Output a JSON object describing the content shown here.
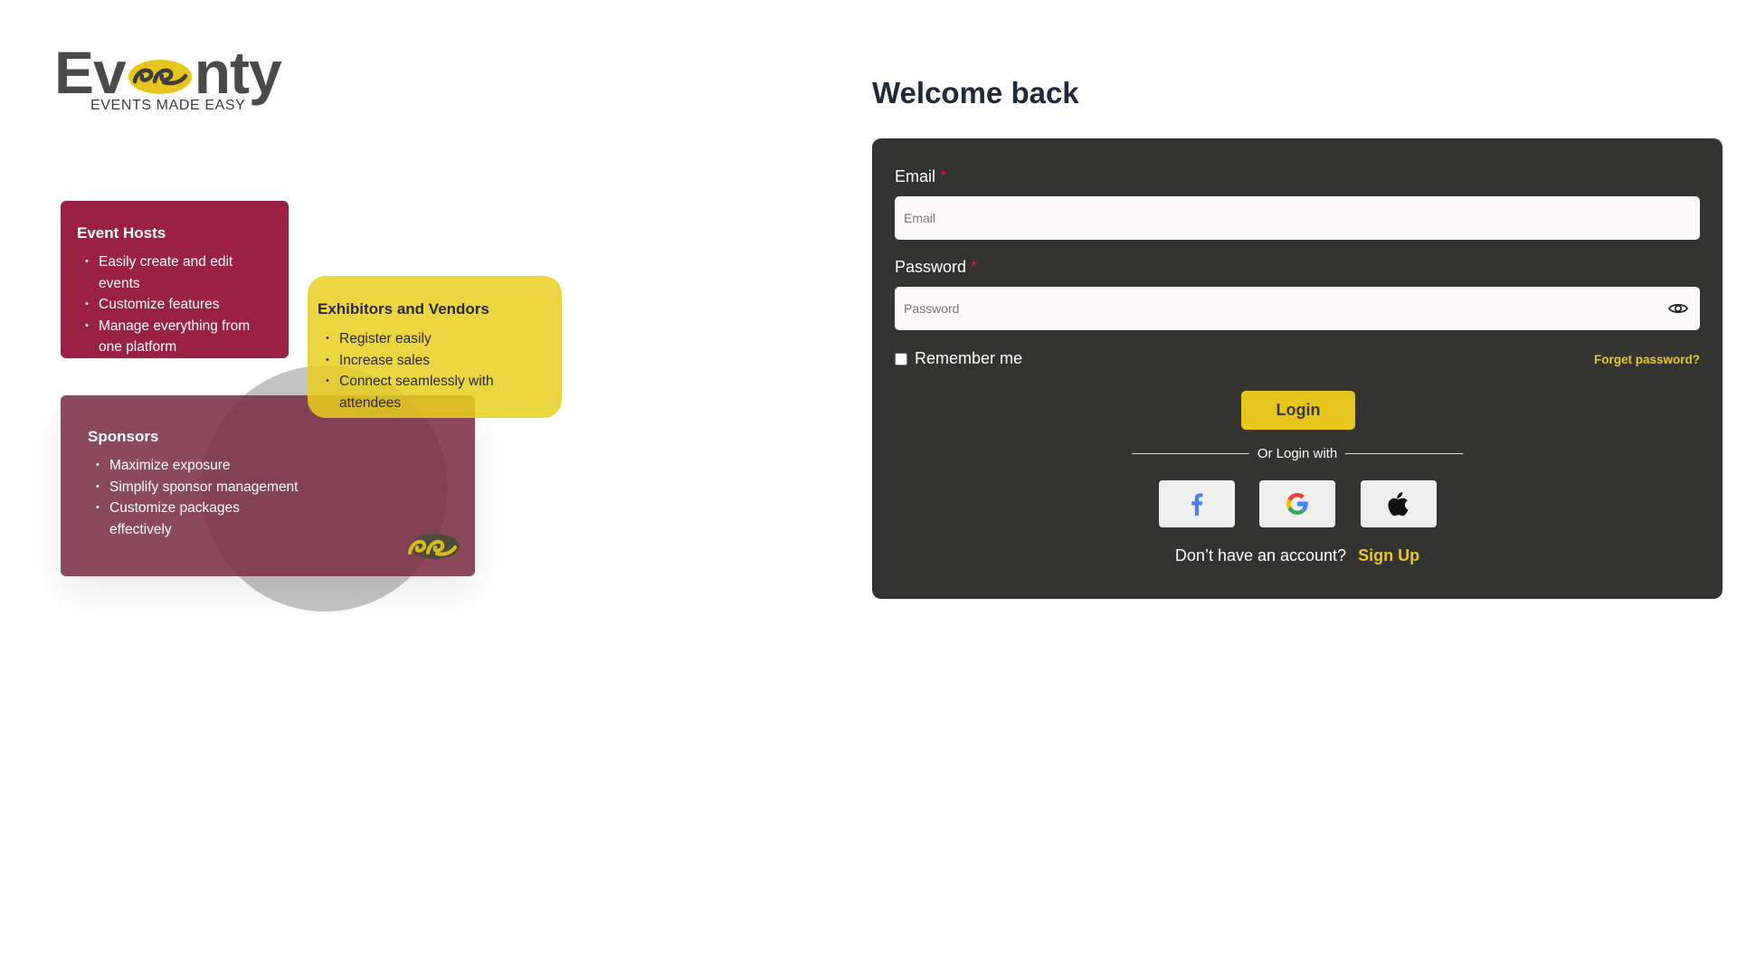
{
  "brand": {
    "logo_part1": "Ev",
    "logo_part2": "nty",
    "tagline": "EVENTS MADE EASY",
    "colors": {
      "primary_yellow": "#e6c61d",
      "crimson": "#9b2144",
      "plum": "#782b42",
      "text_dark": "#4a4a4a"
    }
  },
  "features": {
    "hosts": {
      "title": "Event Hosts",
      "items": [
        "Easily create and edit events",
        "Customize features",
        "Manage everything from one platform"
      ]
    },
    "vendors": {
      "title": "Exhibitors and Vendors",
      "items": [
        "Register easily",
        "Increase sales",
        "Connect seamlessly with attendees"
      ]
    },
    "sponsors": {
      "title": "Sponsors",
      "items": [
        "Maximize exposure",
        "Simplify sponsor management",
        "Customize packages effectively"
      ]
    }
  },
  "login": {
    "heading": "Welcome back",
    "email": {
      "label": "Email",
      "required_mark": "*",
      "placeholder": "Email",
      "value": ""
    },
    "password": {
      "label": "Password",
      "required_mark": "*",
      "placeholder": "Password",
      "value": "",
      "toggle_icon": "eye-icon"
    },
    "remember_label": "Remember me",
    "forget_label": "Forget password?",
    "submit_label": "Login",
    "divider_label": "Or Login with",
    "social_icons": [
      "facebook-icon",
      "google-icon",
      "apple-icon"
    ],
    "signup_prompt": "Don’t have an account?",
    "signup_label": "Sign Up"
  }
}
